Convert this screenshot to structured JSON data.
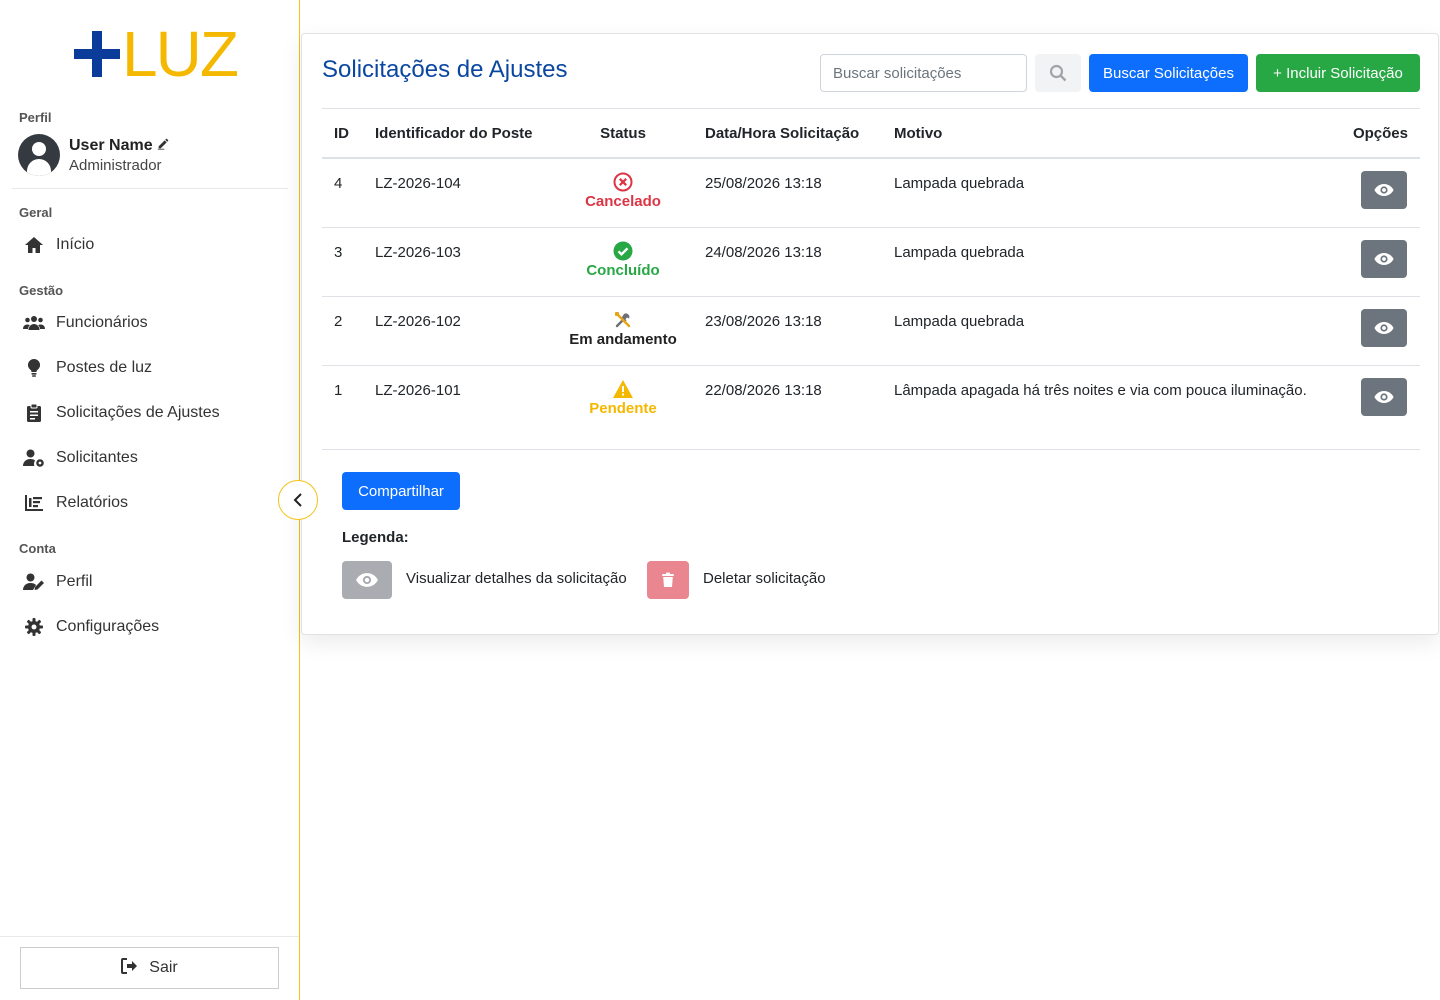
{
  "logo": {
    "text": "LUZ"
  },
  "sidebar": {
    "profile_section": "Perfil",
    "user_name": "User Name",
    "user_role": "Administrador",
    "section_geral": "Geral",
    "section_gestao": "Gestão",
    "section_conta": "Conta",
    "items": [
      {
        "label": "Início",
        "icon": "home-icon"
      },
      {
        "label": "Funcionários",
        "icon": "users-icon"
      },
      {
        "label": "Postes de luz",
        "icon": "lightbulb-icon"
      },
      {
        "label": "Solicitações de Ajustes",
        "icon": "clipboard-icon"
      },
      {
        "label": "Solicitantes",
        "icon": "user-gear-icon"
      },
      {
        "label": "Relatórios",
        "icon": "chart-icon"
      },
      {
        "label": "Perfil",
        "icon": "user-edit-icon"
      },
      {
        "label": "Configurações",
        "icon": "gear-icon"
      }
    ],
    "logout_label": "Sair"
  },
  "main": {
    "title": "Solicitações de Ajustes",
    "search_placeholder": "Buscar solicitações",
    "search_button": "Buscar Solicitações",
    "add_button": "+ Incluir Solicitação",
    "columns": [
      "ID",
      "Identificador do Poste",
      "Status",
      "Data/Hora Solicitação",
      "Motivo",
      "Opções"
    ],
    "rows": [
      {
        "id": "4",
        "poste": "LZ-2026-104",
        "status": "Cancelado",
        "datetime": "25/08/2026 13:18",
        "motivo": "Lampada quebrada"
      },
      {
        "id": "3",
        "poste": "LZ-2026-103",
        "status": "Concluído",
        "datetime": "24/08/2026 13:18",
        "motivo": "Lampada quebrada"
      },
      {
        "id": "2",
        "poste": "LZ-2026-102",
        "status": "Em andamento",
        "datetime": "23/08/2026 13:18",
        "motivo": "Lampada quebrada"
      },
      {
        "id": "1",
        "poste": "LZ-2026-101",
        "status": "Pendente",
        "datetime": "22/08/2026 13:18",
        "motivo": "Lâmpada apagada há três noites e via com pouca iluminação."
      }
    ],
    "share_button": "Compartilhar",
    "legend_title": "Legenda:",
    "legend_view": "Visualizar detalhes da solicitação",
    "legend_delete": "Deletar solicitação"
  },
  "colors": {
    "primary": "#0d6efd",
    "success": "#28a745",
    "danger": "#dc3545",
    "warning": "#f5b800",
    "brand_blue": "#0b3c99",
    "brand_yellow": "#f5b800"
  }
}
